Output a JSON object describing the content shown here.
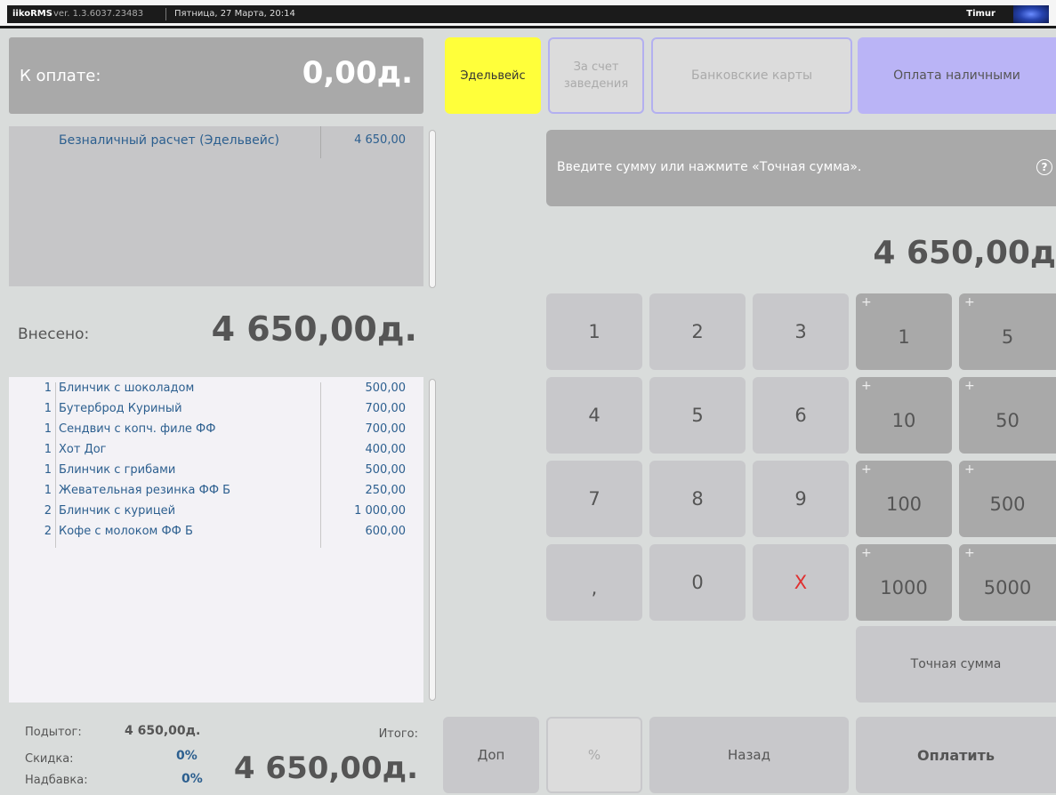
{
  "titlebar": {
    "app": "iikoRMS",
    "version": "ver. 1.3.6037.23483",
    "datetime": "Пятница, 27 Марта, 20:14",
    "user": "Timur"
  },
  "left": {
    "to_pay_label": "К оплате:",
    "to_pay_value": "0,00д.",
    "payments": [
      {
        "name": "Безналичный расчет (Эдельвейс)",
        "sum": "4 650,00"
      }
    ],
    "deposited_label": "Внесено:",
    "deposited_value": "4 650,00д.",
    "items": [
      {
        "qty": "1",
        "name": "Блинчик с шоколадом",
        "price": "500,00"
      },
      {
        "qty": "1",
        "name": "Бутерброд Куриный",
        "price": "700,00"
      },
      {
        "qty": "1",
        "name": "Сендвич с копч. филе ФФ",
        "price": "700,00"
      },
      {
        "qty": "1",
        "name": "Хот Дог",
        "price": "400,00"
      },
      {
        "qty": "1",
        "name": "Блинчик с грибами",
        "price": "500,00"
      },
      {
        "qty": "1",
        "name": "Жевательная резинка ФФ Б",
        "price": "250,00"
      },
      {
        "qty": "2",
        "name": "Блинчик с курицей",
        "price": "1 000,00"
      },
      {
        "qty": "2",
        "name": "Кофе с молоком ФФ Б",
        "price": "600,00"
      }
    ],
    "totals": {
      "subtotal_label": "Подытог:",
      "subtotal_value": "4 650,00д.",
      "discount_label": "Скидка:",
      "discount_value": "0%",
      "surcharge_label": "Надбавка:",
      "surcharge_value": "0%",
      "total_label": "Итого:",
      "total_value": "4 650,00д."
    }
  },
  "right": {
    "methods": {
      "edelweiss": "Эдельвейс",
      "house_line1": "За счет",
      "house_line2": "заведения",
      "bank_cards": "Банковские карты",
      "cash": "Оплата наличными"
    },
    "hint": "Введите сумму или нажмите «Точная сумма».",
    "hint_icon": "?",
    "entry_value": "4 650,00д",
    "keypad": [
      "1",
      "2",
      "3",
      "4",
      "5",
      "6",
      "7",
      "8",
      "9",
      ",",
      "0",
      "X"
    ],
    "quick": [
      "1",
      "5",
      "10",
      "50",
      "100",
      "500",
      "1000",
      "5000"
    ],
    "quick_prefix": "+",
    "exact_sum": "Точная сумма",
    "bottom": {
      "extra": "Доп",
      "percent": "%",
      "back": "Назад",
      "pay": "Оплатить"
    }
  },
  "colors": {
    "edelweiss": "#ffff3a",
    "cash": "#bab4f6",
    "link_blue": "#2c5f8f",
    "cancel_red": "#e03030"
  }
}
